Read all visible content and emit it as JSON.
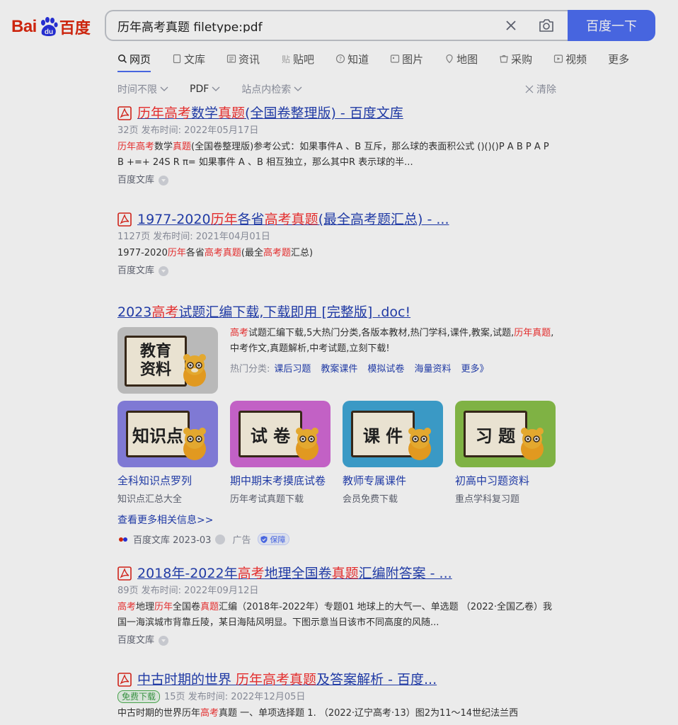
{
  "header": {
    "logo_text_left": "Bai",
    "logo_text_right": "百度",
    "search_value": "历年高考真题 filetype:pdf",
    "search_button": "百度一下"
  },
  "tabs": [
    {
      "label": "网页",
      "icon": "search-icon",
      "active": true
    },
    {
      "label": "文库",
      "icon": "doc-icon"
    },
    {
      "label": "资讯",
      "icon": "news-icon"
    },
    {
      "label": "贴吧",
      "icon": "tieba-icon"
    },
    {
      "label": "知道",
      "icon": "question-icon"
    },
    {
      "label": "图片",
      "icon": "image-icon"
    },
    {
      "label": "地图",
      "icon": "map-icon"
    },
    {
      "label": "采购",
      "icon": "cart-icon"
    },
    {
      "label": "视频",
      "icon": "video-icon"
    },
    {
      "label": "更多",
      "icon": ""
    }
  ],
  "filters": {
    "time": "时间不限",
    "format": "PDF",
    "site": "站点内检索",
    "clear": "清除"
  },
  "results": [
    {
      "title_parts": [
        [
          "历年高考",
          true
        ],
        [
          "数学",
          false
        ],
        [
          "真题",
          true
        ],
        [
          "(全国卷整理版) - 百度文库",
          false
        ]
      ],
      "meta": "32页 发布时间: 2022年05月17日",
      "snippet_parts": [
        [
          "历年高考",
          true
        ],
        [
          "数学",
          false
        ],
        [
          "真题",
          true
        ],
        [
          "(全国卷整理版)参考公式：如果事件A 、B 互斥，那么球的表面积公式 ()()()P A B P A P B +=+ 24S R π= 如果事件 A 、B 相互独立，那么其中R 表示球的半...",
          false
        ]
      ],
      "source": "百度文库"
    },
    {
      "title_parts": [
        [
          "1977-2020",
          false
        ],
        [
          "历年",
          true
        ],
        [
          "各省",
          false
        ],
        [
          "高考真题",
          true
        ],
        [
          "(最全高考题汇总) - ...",
          false
        ]
      ],
      "meta": "1127页 发布时间: 2021年04月01日",
      "snippet_parts": [
        [
          "1977-2020",
          false
        ],
        [
          "历年",
          true
        ],
        [
          "各省",
          false
        ],
        [
          "高考真题",
          true
        ],
        [
          "(最全",
          false
        ],
        [
          "高考题",
          true
        ],
        [
          "汇总)",
          false
        ]
      ],
      "source": "百度文库"
    },
    {
      "title_parts": [
        [
          "2018年-2022年",
          false
        ],
        [
          "高考",
          true
        ],
        [
          "地理全国卷",
          false
        ],
        [
          "真题",
          true
        ],
        [
          "汇编附答案 - ...",
          false
        ]
      ],
      "meta": "89页 发布时间: 2022年09月12日",
      "snippet_parts": [
        [
          "高考",
          true
        ],
        [
          "地理",
          false
        ],
        [
          "历年",
          true
        ],
        [
          "全国卷",
          false
        ],
        [
          "真题",
          true
        ],
        [
          "汇编（2018年-2022年）专题01 地球上的大气一、单选题 （2022·全国乙卷）我国一海滨城市背靠丘陵，某日海陆风明显。下图示意当日该市不同高度的风随...",
          false
        ]
      ],
      "source": "百度文库"
    },
    {
      "title_parts": [
        [
          "中古时期的世界 ",
          false
        ],
        [
          "历年高考真题",
          true
        ],
        [
          "及答案解析 - 百度...",
          false
        ]
      ],
      "free_badge": "免费下载",
      "meta": "15页 发布时间: 2022年12月05日",
      "snippet_parts": [
        [
          "中古时期的世界历年",
          false
        ],
        [
          "高考",
          true
        ],
        [
          "真题 一、单项选择题 1. （2022·辽宁高考·13）图2为11～14世纪法兰西",
          false
        ]
      ]
    }
  ],
  "ad": {
    "title_parts": [
      [
        "2023",
        false
      ],
      [
        "高考",
        true
      ],
      [
        "试题汇编下载,下载即用 [完整版] .doc!",
        false
      ]
    ],
    "desc_parts": [
      [
        "高考",
        true
      ],
      [
        "试题汇编下载,5大热门分类,各版本教材,热门学科,课件,教案,试题,",
        false
      ],
      [
        "历年真题",
        true
      ],
      [
        ",中考作文,真题解析,中考试题,立刻下载!",
        false
      ]
    ],
    "main_image_text": "教育资料",
    "hot_label": "热门分类:",
    "hot_links": [
      "课后习题",
      "教案课件",
      "模拟试卷",
      "海量资料",
      "更多》"
    ],
    "cards": [
      {
        "image_text": "知识点",
        "title": "全科知识点罗列",
        "sub": "知识点汇总大全",
        "color": "#8a84e6"
      },
      {
        "image_text": "试 卷",
        "title": "期中期末考摸底试卷",
        "sub": "历年考试真题下载",
        "color": "#d36ad6"
      },
      {
        "image_text": "课 件",
        "title": "教师专属课件",
        "sub": "会员免费下载",
        "color": "#3fa6d6"
      },
      {
        "image_text": "习 题",
        "title": "初高中习题资料",
        "sub": "重点学科复习题",
        "color": "#8ac24a"
      }
    ],
    "more": "查看更多相关信息>>",
    "source": "百度文库 2023-03",
    "ad_label": "广告",
    "guarantee": "保障"
  }
}
